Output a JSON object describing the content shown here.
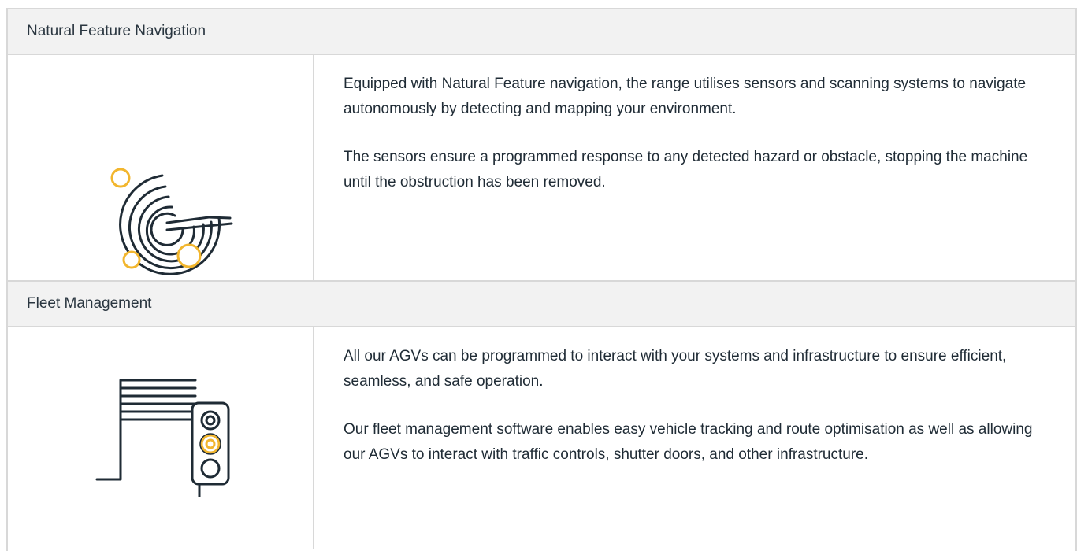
{
  "sections": [
    {
      "title": "Natural Feature Navigation",
      "icon": "radar-scan-icon",
      "paragraphs": [
        "Equipped with Natural Feature navigation, the range utilises sensors and scanning systems to navigate autonomously by detecting and mapping your environment.",
        "The sensors ensure a programmed response to any detected hazard or obstacle, stopping the machine until the obstruction has been removed."
      ]
    },
    {
      "title": "Fleet Management",
      "icon": "shutter-door-traffic-light-icon",
      "paragraphs": [
        "All our AGVs can be programmed to interact with your systems and infrastructure to ensure efficient, seamless, and safe operation.",
        "Our fleet management software enables easy vehicle tracking and route optimisation as well as allowing our AGVs to interact with traffic controls, shutter doors, and other infrastructure."
      ]
    }
  ],
  "colors": {
    "border": "#d8d8d8",
    "header_bg": "#f2f2f2",
    "icon_stroke": "#1f2b35",
    "accent": "#f2b62e"
  }
}
